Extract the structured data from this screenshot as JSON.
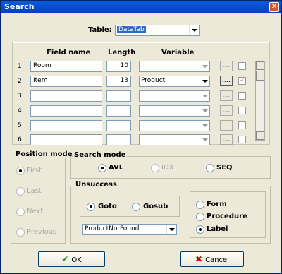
{
  "window": {
    "title": "Search",
    "close_glyph": "✕"
  },
  "table_selector": {
    "label": "Table:",
    "value": "DataTab"
  },
  "grid": {
    "headers": {
      "field_name": "Field name",
      "length": "Length",
      "variable": "Variable"
    },
    "rows": [
      {
        "num": "1",
        "field": "Room",
        "length": "10",
        "variable": "",
        "dots": "....",
        "checked": false
      },
      {
        "num": "2",
        "field": "Item",
        "length": "13",
        "variable": "Product",
        "dots": "....",
        "checked": true
      },
      {
        "num": "3",
        "field": "",
        "length": "",
        "variable": "",
        "dots": "....",
        "checked": false
      },
      {
        "num": "4",
        "field": "",
        "length": "",
        "variable": "",
        "dots": "....",
        "checked": false
      },
      {
        "num": "5",
        "field": "",
        "length": "",
        "variable": "",
        "dots": "....",
        "checked": false
      },
      {
        "num": "6",
        "field": "",
        "length": "",
        "variable": "",
        "dots": "....",
        "checked": false
      }
    ]
  },
  "position_mode": {
    "title": "Position mode",
    "options": [
      "First",
      "Last",
      "Next",
      "Previous"
    ],
    "selected": "First",
    "enabled": false
  },
  "search_mode": {
    "title": "Search mode",
    "options": [
      "AVL",
      "IDX",
      "SEQ"
    ],
    "selected": "AVL"
  },
  "unsuccess": {
    "title": "Unsuccess",
    "jump_options": [
      "Goto",
      "Gosub"
    ],
    "jump_selected": "Goto",
    "target_value": "ProductNotFound",
    "kind_options": [
      "Form",
      "Procedure",
      "Label"
    ],
    "kind_selected": "Label"
  },
  "buttons": {
    "ok": "OK",
    "cancel": "Cancel"
  },
  "icons": {
    "ok": "check-icon",
    "cancel": "x-icon"
  }
}
